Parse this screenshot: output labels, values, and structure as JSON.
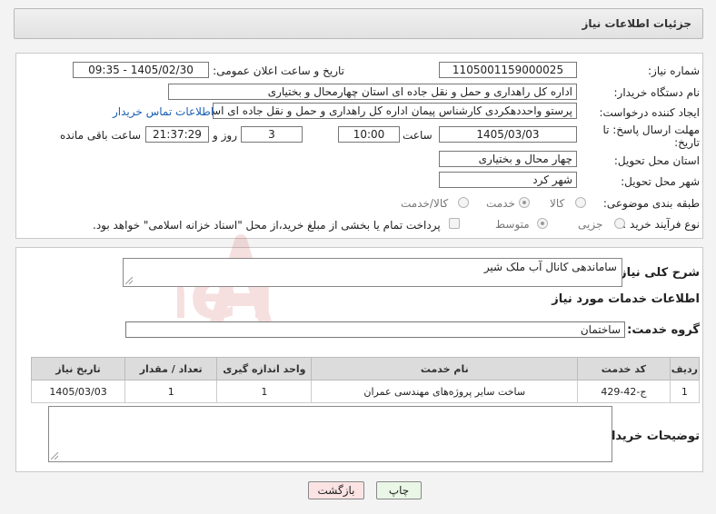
{
  "header": {
    "title": "جزئیات اطلاعات نیاز"
  },
  "need_number": {
    "label": "شماره نیاز:",
    "value": "1105001159000025"
  },
  "announce": {
    "label": "تاریخ و ساعت اعلان عمومی:",
    "value": "1405/02/30 - 09:35"
  },
  "buyer_org": {
    "label": "نام دستگاه خریدار:",
    "value": "اداره کل راهداری و حمل و نقل جاده ای استان چهارمحال و بختیاری"
  },
  "requester": {
    "label": "ایجاد کننده درخواست:",
    "value": "پرستو واحددهکردی کارشناس پیمان اداره کل راهداری و حمل و نقل جاده ای است",
    "contact_link": "اطلاعات تماس خریدار"
  },
  "deadline": {
    "label_line1": "مهلت ارسال پاسخ: تا",
    "label_line2": "تاریخ:",
    "date": "1405/03/03",
    "time_label": "ساعت",
    "time": "10:00",
    "days": "3",
    "days_label": "روز و",
    "remaining": "21:37:29",
    "remaining_label": "ساعت باقی مانده"
  },
  "province": {
    "label": "استان محل تحویل:",
    "value": "چهار محال و بختیاری"
  },
  "city": {
    "label": "شهر محل تحویل:",
    "value": "شهر کرد"
  },
  "category": {
    "label": "طبقه بندی موضوعی:",
    "options": [
      "کالا",
      "خدمت",
      "کالا/خدمت"
    ],
    "selected": "خدمت"
  },
  "purchase_type": {
    "label": "نوع فرآیند خرید :",
    "options": [
      "جزیی",
      "متوسط"
    ],
    "selected": "متوسط",
    "note": "پرداخت تمام یا بخشی از مبلغ خرید،از محل \"اسناد خزانه اسلامی\" خواهد بود."
  },
  "description": {
    "label": "شرح کلی نیاز:",
    "value": "ساماندهی کانال آب ملک شیر"
  },
  "services_title": "اطلاعات خدمات مورد نیاز",
  "service_group": {
    "label": "گروه خدمت:",
    "value": "ساختمان"
  },
  "table": {
    "headers": [
      "ردیف",
      "کد خدمت",
      "نام خدمت",
      "واحد اندازه گیری",
      "تعداد / مقدار",
      "تاریخ نیاز"
    ],
    "rows": [
      [
        "1",
        "ج-42-429",
        "ساخت سایر پروژه‌های مهندسی عمران",
        "1",
        "1",
        "1405/03/03"
      ]
    ]
  },
  "buyer_notes": {
    "label": "توضیحات خریدار:",
    "value": ""
  },
  "buttons": {
    "print": "چاپ",
    "back": "بازگشت"
  },
  "watermark": {
    "text": "AriaTender.neT",
    "color": "#c62828"
  }
}
